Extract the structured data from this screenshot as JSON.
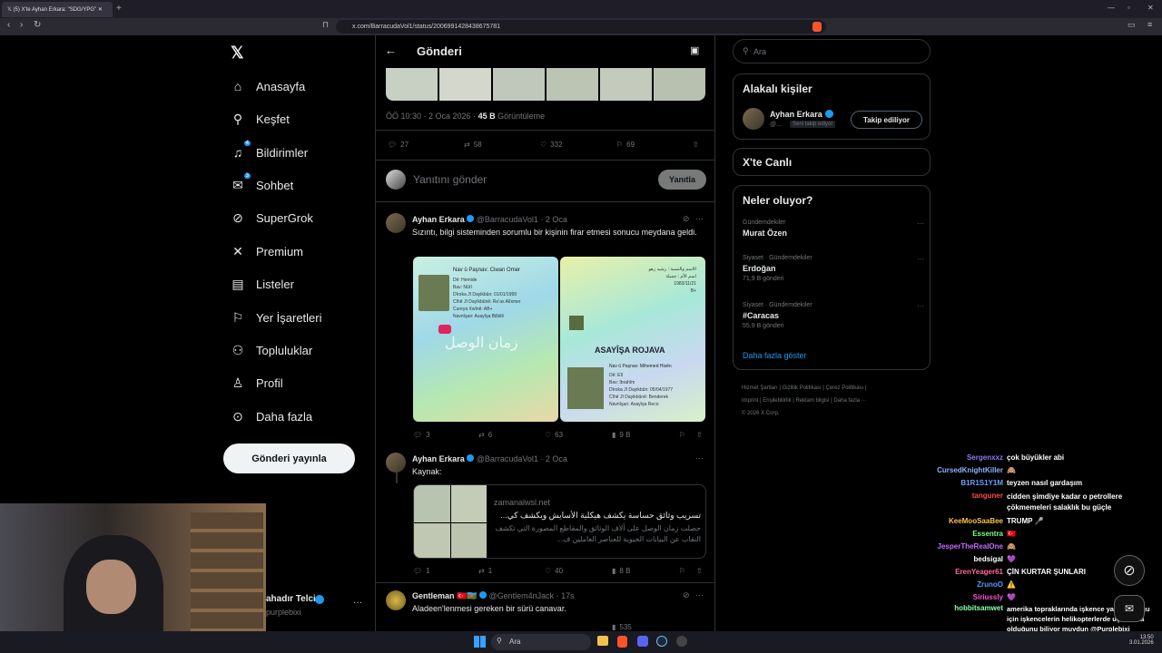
{
  "browser": {
    "tab_title": "(5) X'te Ayhan Erkara: \"SDG/YPG\"",
    "url": "x.com/BarracudaVol1/status/2006991428438675781"
  },
  "nav": {
    "items": [
      {
        "label": "Anasayfa"
      },
      {
        "label": "Keşfet"
      },
      {
        "label": "Bildirimler",
        "badge": "4"
      },
      {
        "label": "Sohbet",
        "badge": "3"
      },
      {
        "label": "SuperGrok"
      },
      {
        "label": "Premium"
      },
      {
        "label": "Listeler"
      },
      {
        "label": "Yer İşaretleri"
      },
      {
        "label": "Topluluklar"
      },
      {
        "label": "Profil"
      },
      {
        "label": "Daha fazla"
      }
    ],
    "post_button": "Gönderi yayınla",
    "account_name": "ahadır Telci",
    "account_handle": "purplebixi"
  },
  "header": {
    "title": "Gönderi"
  },
  "main_post": {
    "time": "ÖÖ 10:30 · 2 Oca 2026 ·",
    "views": "45 B",
    "views_label": "Görüntüleme",
    "replies": "27",
    "reposts": "58",
    "likes": "332",
    "bookmarks": "69"
  },
  "reply_box": {
    "placeholder": "Yanıtını gönder",
    "button": "Yanıtla"
  },
  "replies": [
    {
      "name": "Ayhan Erkara",
      "handle": "@BarracudaVol1 · 2 Oca",
      "text": "Sızıntı, bilgi sisteminden sorumlu bir kişinin firar etmesi sonucu meydana geldi.",
      "stats": {
        "replies": "3",
        "reposts": "6",
        "likes": "63",
        "views": "9 B"
      },
      "card_texts": {
        "left_title": "Nav û Paşnav: Ciwan Omer",
        "right_title": "ASAYÎŞA ROJAVA",
        "right_name": "Nav û Paşnav: Mihemed Hisên"
      }
    },
    {
      "name": "Ayhan Erkara",
      "handle": "@BarracudaVol1 · 2 Oca",
      "text": "Kaynak:",
      "link": {
        "domain": "zamanalwsl.net",
        "title": "تسريب وثائق حساسة يكشف هيكلية الأسايش ويكشف كي...",
        "desc": "حصلت زمان الوصل على آلاف الوثائق والمقاطع المصورة التي تكشف النقاب عن البيانات الحيوية للعناصر العاملين ف..."
      },
      "stats": {
        "replies": "1",
        "reposts": "1",
        "likes": "40",
        "views": "8 B"
      }
    },
    {
      "name": "Gentleman",
      "handle": "@Gentlem4nJack · 17s",
      "text": "Aladeen'lenmesi gereken bir sürü canavar.",
      "stats": {
        "views": "535"
      }
    }
  ],
  "right": {
    "search_placeholder": "Ara",
    "related_title": "Alakalı kişiler",
    "related_name": "Ayhan Erkara",
    "related_handle": "@...",
    "follows_you": "Seni takip ediyor",
    "follow_button": "Takip ediliyor",
    "live_title": "X'te Canlı",
    "trends_title": "Neler oluyor?",
    "trends": [
      {
        "category": "Gündemdekiler",
        "name": "Murat Özen",
        "count": ""
      },
      {
        "category": "Siyaset · Gündemdekiler",
        "name": "Erdoğan",
        "count": "71,9 B gönderi"
      },
      {
        "category": "Siyaset · Gündemdekiler",
        "name": "#Caracas",
        "count": "55,9 B gönderi"
      }
    ],
    "show_more": "Daha fazla göster",
    "footer": [
      "Hizmet Şartları",
      "Gizlilik Politikası",
      "Çerez Politikası",
      "Imprint",
      "Erişilebilirlik",
      "Reklam bilgisi",
      "Daha fazla ···",
      "© 2026 X Corp."
    ]
  },
  "chat": [
    {
      "user": "Sergenxxz",
      "msg": "çok büyükler abi",
      "color": "#8a7cf0"
    },
    {
      "user": "CursedKnightKiller",
      "msg": "🙈",
      "color": "#8ab4ff"
    },
    {
      "user": "B1R1S1Y1M",
      "msg": "teyzen nasıl gardaşım",
      "color": "#6aa0ff"
    },
    {
      "user": "tanguner",
      "msg": "cidden şimdiye kadar o petrollere çökmemeleri salaklık bu güçle",
      "color": "#ff4d4d"
    },
    {
      "user": "KeeMooSaaBee",
      "msg": "TRUMP 🎤",
      "color": "#ffc24d"
    },
    {
      "user": "Essentra",
      "msg": "🇹🇷",
      "color": "#7cff7c"
    },
    {
      "user": "JesperTheRealOne",
      "msg": "🙈",
      "color": "#c86bff"
    },
    {
      "user": "bedsigal",
      "msg": "💜",
      "color": "#ffffff"
    },
    {
      "user": "ErenYeager61",
      "msg": "ÇİN KURTAR ŞUNLARI",
      "color": "#ff6b9d"
    },
    {
      "user": "ZrunoO",
      "msg": "⚠️",
      "color": "#4d9dff"
    },
    {
      "user": "Siriussly",
      "msg": "💜",
      "color": "#ff4dd2"
    },
    {
      "user": "hobbitsamwet",
      "msg": "amerika topraklarında işkence yasak olduğu için işkencelerin helikopterlerde uçaklarda olduğunu biliyor muydun @Purplebixi",
      "color": "#8cffb3"
    }
  ],
  "taskbar": {
    "search": "Ara",
    "time": "13:50",
    "date": "3.01.2026"
  }
}
